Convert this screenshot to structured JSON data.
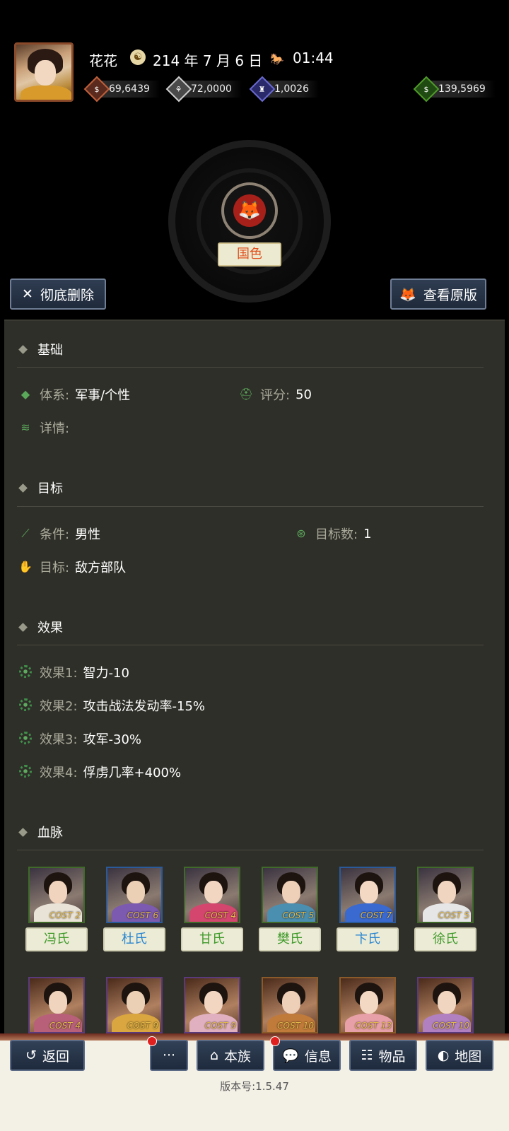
{
  "header": {
    "player_name": "花花",
    "date": "214 年 7 月 6 日",
    "time": "01:44",
    "resources": [
      {
        "icon": "coin-icon",
        "value": "69,6439",
        "color": "#c0603a"
      },
      {
        "icon": "grain-icon",
        "value": "72,0000",
        "color": "#cfcfcf"
      },
      {
        "icon": "soldier-icon",
        "value": "1,0026",
        "color": "#6a6ad0"
      },
      {
        "icon": "money-bag-icon",
        "value": "139,5969",
        "color": "#4f9a2a"
      }
    ]
  },
  "trait": {
    "tag": "国色",
    "delete_label": "彻底删除",
    "view_original_label": "查看原版"
  },
  "basic": {
    "title": "基础",
    "system_label": "体系:",
    "system_value": "军事/个性",
    "score_label": "评分:",
    "score_value": "50",
    "detail_label": "详情:"
  },
  "target": {
    "title": "目标",
    "condition_label": "条件:",
    "condition_value": "男性",
    "count_label": "目标数:",
    "count_value": "1",
    "target_label": "目标:",
    "target_value": "敌方部队"
  },
  "effects": {
    "title": "效果",
    "items": [
      {
        "label": "效果1:",
        "value": "智力-10"
      },
      {
        "label": "效果2:",
        "value": "攻击战法发动率-15%"
      },
      {
        "label": "效果3:",
        "value": "攻军-30%"
      },
      {
        "label": "效果4:",
        "value": "俘虏几率+400%"
      }
    ]
  },
  "lineage": {
    "title": "血脉",
    "row1": [
      {
        "name": "冯氏",
        "cost": "COST 2",
        "name_color": "#3f9a2a",
        "robe": "#e9e2d6"
      },
      {
        "name": "杜氏",
        "cost": "COST 6",
        "name_color": "#2a86d0",
        "robe": "#7c5ab0"
      },
      {
        "name": "甘氏",
        "cost": "COST 4",
        "name_color": "#3f9a2a",
        "robe": "#d4466e"
      },
      {
        "name": "樊氏",
        "cost": "COST 5",
        "name_color": "#3f9a2a",
        "robe": "#4a8fb0"
      },
      {
        "name": "卞氏",
        "cost": "COST 7",
        "name_color": "#2a86d0",
        "robe": "#3a6ad0"
      },
      {
        "name": "徐氏",
        "cost": "COST 5",
        "name_color": "#3f9a2a",
        "robe": "#e6e6e6"
      }
    ],
    "row2": [
      {
        "cost": "COST 4",
        "robe": "#b8607a"
      },
      {
        "cost": "COST 9",
        "robe": "#d9a640"
      },
      {
        "cost": "COST 9",
        "robe": "#e0b0c0"
      },
      {
        "cost": "COST 10",
        "robe": "#c07a3a"
      },
      {
        "cost": "COST 13",
        "robe": "#e8a0a8"
      },
      {
        "cost": "COST 10",
        "robe": "#b080c0"
      }
    ]
  },
  "nav": {
    "back": "返回",
    "more": "···",
    "clan": "本族",
    "info": "信息",
    "items": "物品",
    "map": "地图"
  },
  "version": "版本号:1.5.47"
}
